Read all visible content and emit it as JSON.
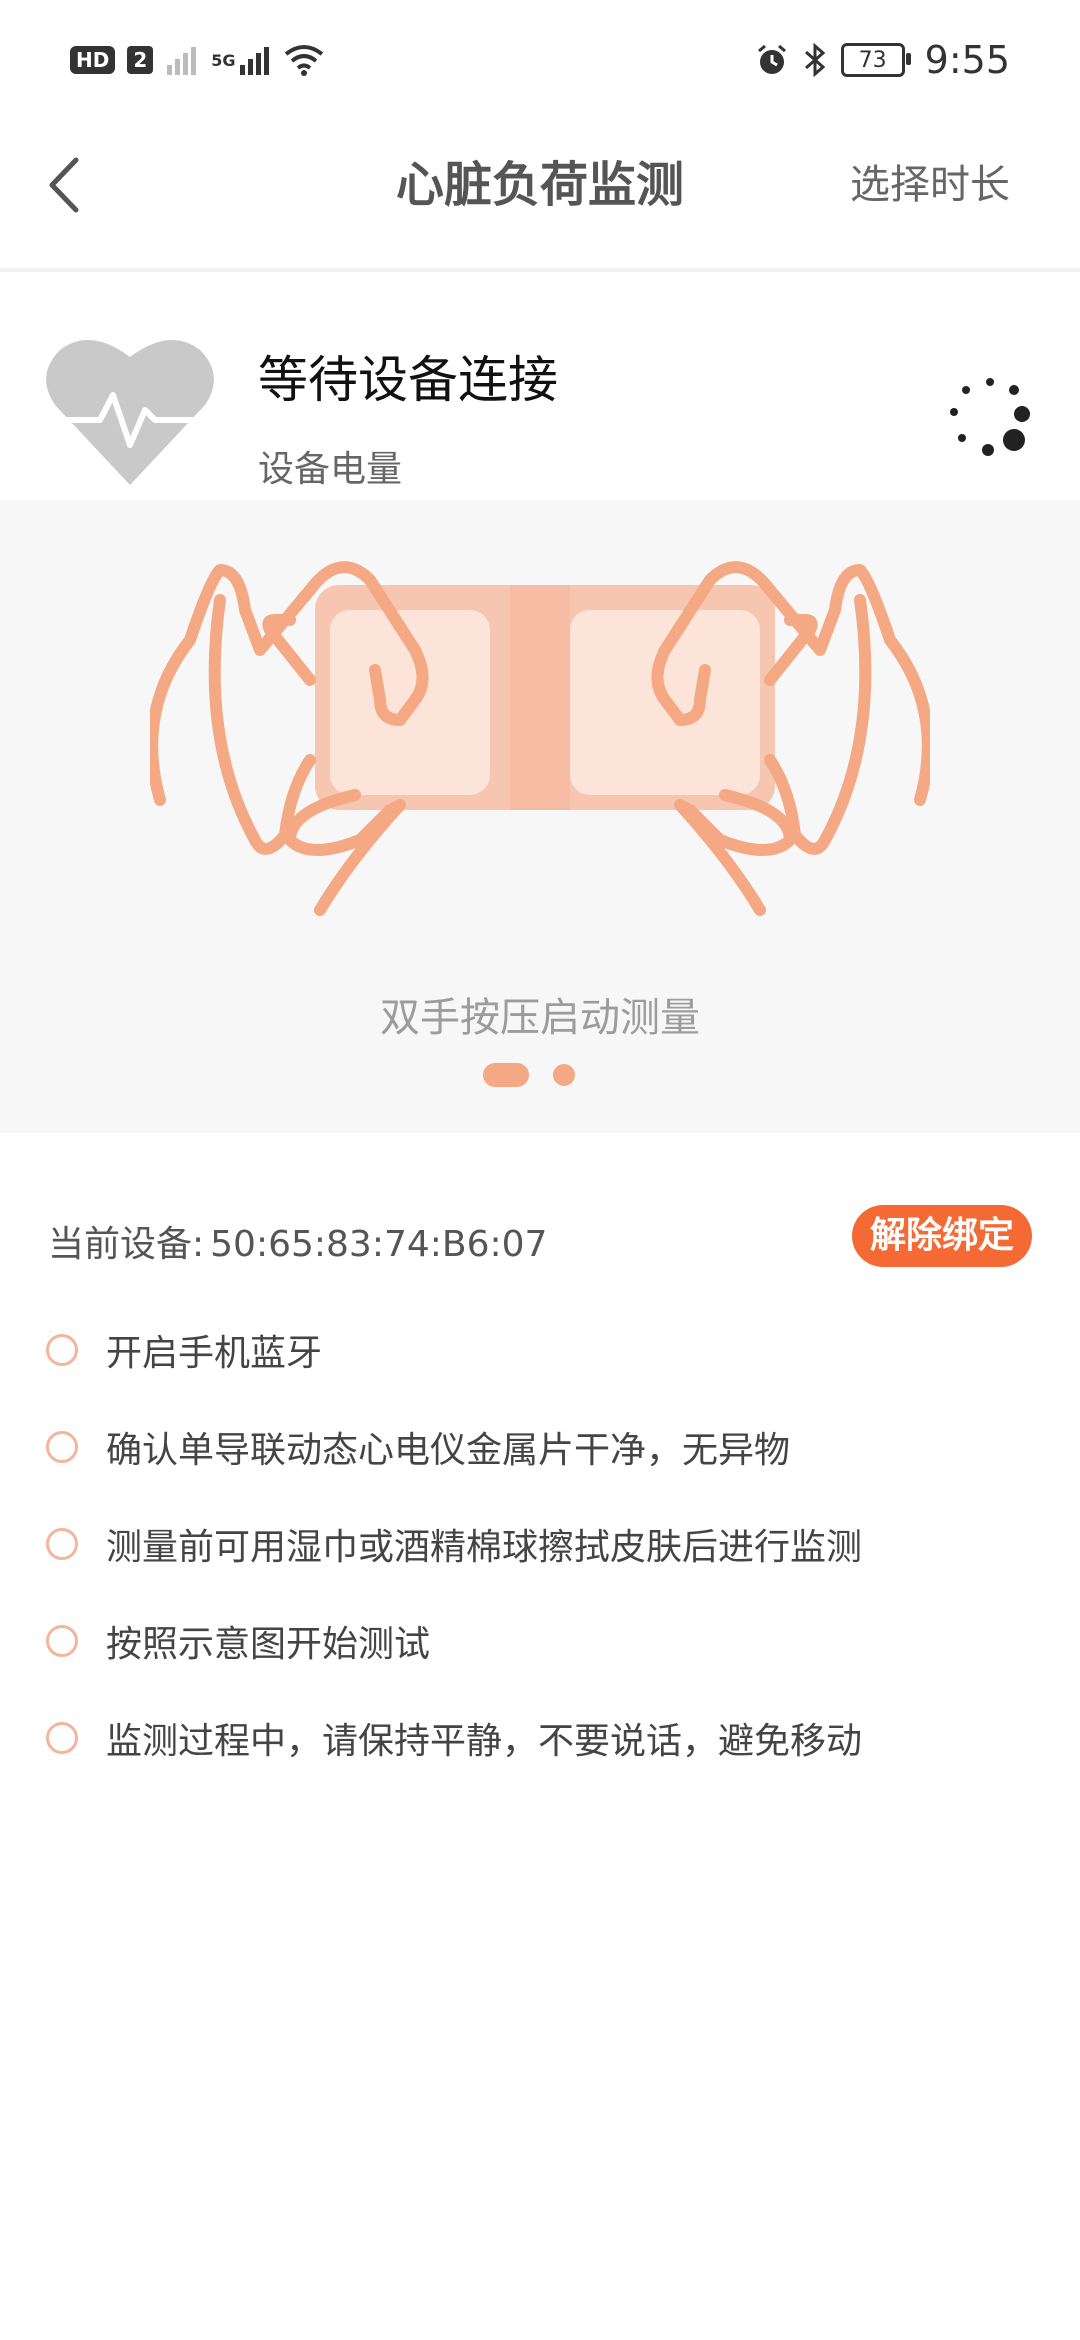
{
  "status_bar": {
    "hd": "HD",
    "sim": "2",
    "network": "5G",
    "battery": "73",
    "time": "9:55"
  },
  "nav": {
    "title": "心脏负荷监测",
    "right_action": "选择时长"
  },
  "device": {
    "status": "等待设备连接",
    "battery_label": "设备电量"
  },
  "illustration": {
    "hint": "双手按压启动测量",
    "page_index": 1,
    "page_count": 2
  },
  "current_device": {
    "label": "当前设备:",
    "mac": "50:65:83:74:B6:07",
    "unbind": "解除绑定"
  },
  "checklist": [
    "开启手机蓝牙",
    "确认单导联动态心电仪金属片干净，无异物",
    "测量前可用湿巾或酒精棉球擦拭皮肤后进行监测",
    "按照示意图开始测试",
    "监测过程中，请保持平静，不要说话，避免移动"
  ],
  "colors": {
    "accent": "#f56a34",
    "illustration": "#f5a884"
  }
}
